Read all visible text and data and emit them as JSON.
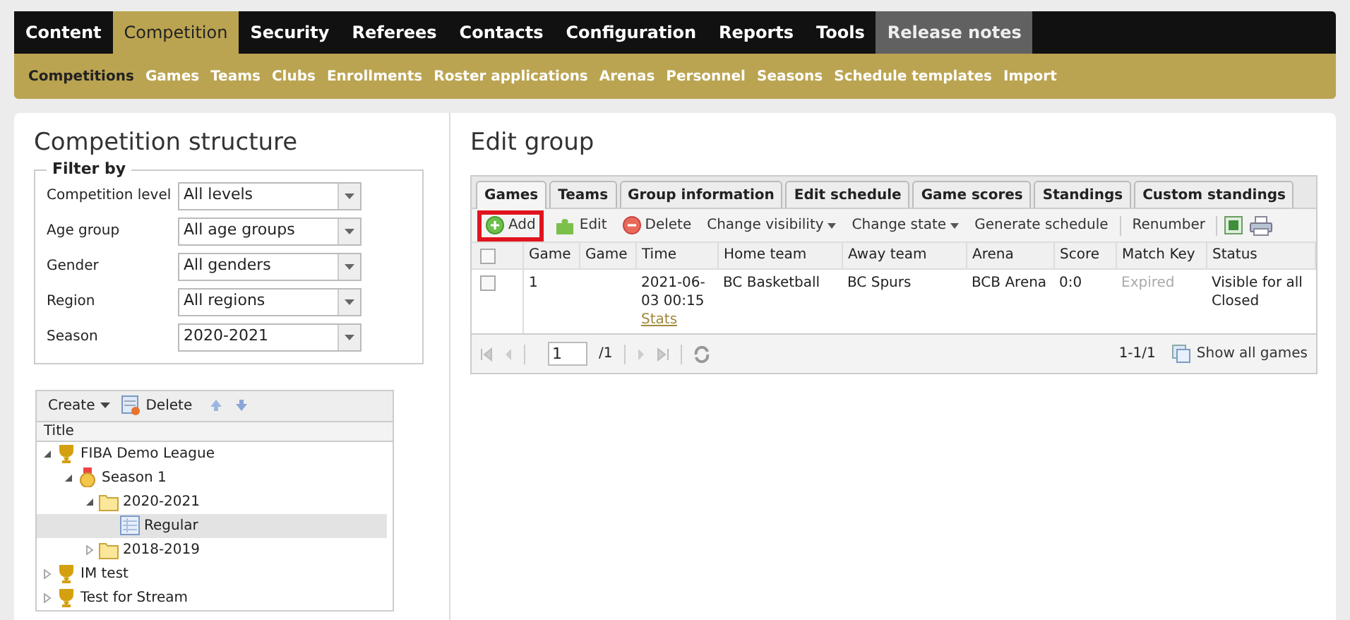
{
  "main_nav": [
    {
      "label": "Content",
      "selected": false,
      "highlighted": false
    },
    {
      "label": "Competition",
      "selected": true,
      "highlighted": false
    },
    {
      "label": "Security",
      "selected": false,
      "highlighted": false
    },
    {
      "label": "Referees",
      "selected": false,
      "highlighted": false
    },
    {
      "label": "Contacts",
      "selected": false,
      "highlighted": false
    },
    {
      "label": "Configuration",
      "selected": false,
      "highlighted": false
    },
    {
      "label": "Reports",
      "selected": false,
      "highlighted": false
    },
    {
      "label": "Tools",
      "selected": false,
      "highlighted": false
    },
    {
      "label": "Release notes",
      "selected": false,
      "highlighted": true
    }
  ],
  "sub_nav": [
    {
      "label": "Competitions",
      "selected": true
    },
    {
      "label": "Games",
      "selected": false
    },
    {
      "label": "Teams",
      "selected": false
    },
    {
      "label": "Clubs",
      "selected": false
    },
    {
      "label": "Enrollments",
      "selected": false
    },
    {
      "label": "Roster applications",
      "selected": false
    },
    {
      "label": "Arenas",
      "selected": false
    },
    {
      "label": "Personnel",
      "selected": false
    },
    {
      "label": "Seasons",
      "selected": false
    },
    {
      "label": "Schedule templates",
      "selected": false
    },
    {
      "label": "Import",
      "selected": false
    }
  ],
  "left": {
    "title": "Competition structure",
    "filter": {
      "legend": "Filter by",
      "fields": [
        {
          "label": "Competition level",
          "value": "All levels"
        },
        {
          "label": "Age group",
          "value": "All age groups"
        },
        {
          "label": "Gender",
          "value": "All genders"
        },
        {
          "label": "Region",
          "value": "All regions"
        },
        {
          "label": "Season",
          "value": "2020-2021"
        }
      ]
    },
    "tree_toolbar": {
      "create": "Create",
      "delete": "Delete"
    },
    "tree_column": "Title",
    "tree": [
      {
        "label": "FIBA Demo League",
        "kind": "competition",
        "expanded": true,
        "selected": false,
        "children": [
          {
            "label": "Season 1",
            "kind": "season",
            "expanded": true,
            "selected": false,
            "children": [
              {
                "label": "2020-2021",
                "kind": "folder",
                "expanded": true,
                "selected": false,
                "children": [
                  {
                    "label": "Regular",
                    "kind": "group",
                    "selected": true
                  }
                ]
              },
              {
                "label": "2018-2019",
                "kind": "folder",
                "expanded": false,
                "selected": false
              }
            ]
          }
        ]
      },
      {
        "label": "IM test",
        "kind": "competition",
        "expanded": false,
        "selected": false
      },
      {
        "label": "Test for Stream",
        "kind": "competition",
        "expanded": false,
        "selected": false
      }
    ]
  },
  "right": {
    "title": "Edit group",
    "tabs": [
      {
        "label": "Games",
        "selected": true
      },
      {
        "label": "Teams",
        "selected": false
      },
      {
        "label": "Group information",
        "selected": false
      },
      {
        "label": "Edit schedule",
        "selected": false
      },
      {
        "label": "Game scores",
        "selected": false
      },
      {
        "label": "Standings",
        "selected": false
      },
      {
        "label": "Custom standings",
        "selected": false
      }
    ],
    "toolbar": [
      {
        "kind": "add",
        "label": "Add",
        "highlighted": true
      },
      {
        "kind": "edit",
        "label": "Edit",
        "highlighted": false
      },
      {
        "kind": "delete",
        "label": "Delete",
        "highlighted": false
      },
      {
        "kind": "menu",
        "label": "Change visibility",
        "highlighted": false
      },
      {
        "kind": "menu",
        "label": "Change state",
        "highlighted": false
      },
      {
        "kind": "plain",
        "label": "Generate schedule",
        "highlighted": false
      },
      {
        "kind": "separator"
      },
      {
        "kind": "plain",
        "label": "Renumber",
        "highlighted": false
      },
      {
        "kind": "separator"
      },
      {
        "kind": "excel"
      },
      {
        "kind": "print"
      }
    ],
    "table": {
      "header_checked": false,
      "columns": [
        "Game",
        "Game",
        "Time",
        "Home team",
        "Away team",
        "Arena",
        "Score",
        "Match Key",
        "Status"
      ],
      "rows": [
        {
          "checked": false,
          "cells": [
            "1",
            "",
            "2021-06-03 00:15",
            "BC Basketball",
            "BC Spurs",
            "BCB Arena",
            "0:0",
            "Expired",
            "Visible for all Closed"
          ],
          "link": "Stats"
        }
      ]
    },
    "pager": {
      "page": "1",
      "of": "/1",
      "range": "1-1/1",
      "show_all": "Show all games"
    }
  }
}
